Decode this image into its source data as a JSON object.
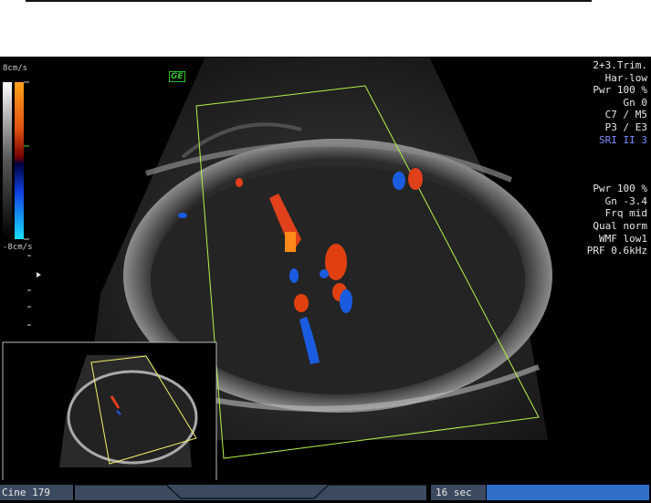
{
  "scale": {
    "top_label": "8cm/s",
    "bottom_label": "-8cm/s"
  },
  "logo": "GE",
  "settings_top": [
    "2+3.Trim.",
    "Har-low",
    "Pwr 100 %",
    "Gn   0",
    "C7 / M5",
    "P3 / E3"
  ],
  "settings_highlight": "SRI II 3",
  "settings_bottom": [
    "Pwr 100 %",
    "Gn -3.4",
    "Frq mid",
    "Qual norm",
    "WMF low1",
    "PRF  0.6kHz"
  ],
  "status": {
    "cine_label": "Cine 179",
    "duration_label": "16 sec",
    "cine_progress": 1.0
  },
  "colors": {
    "frame": "#b6f24a",
    "inset_frame": "#f2f26a",
    "bar_bg": "#3b4a5e",
    "progress": "#2f6fc9",
    "doppler_red": "#e0401a",
    "doppler_blue": "#1a5ce0"
  }
}
